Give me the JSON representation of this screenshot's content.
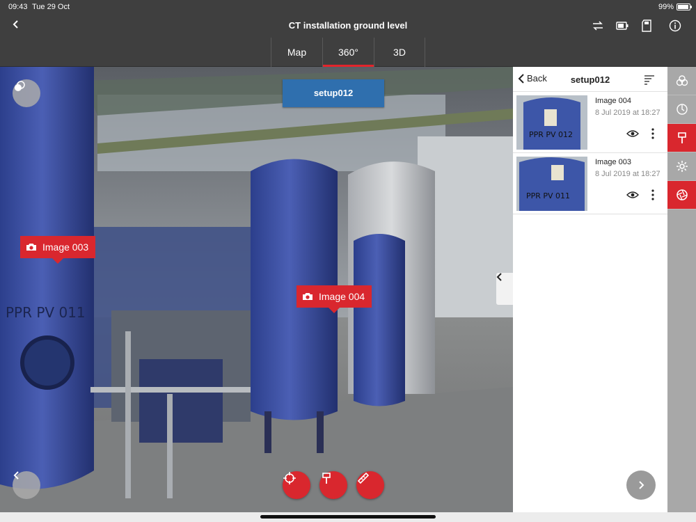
{
  "statusbar": {
    "time": "09:43",
    "date": "Tue 29 Oct",
    "battery": "99%"
  },
  "header": {
    "title": "CT installation ground level"
  },
  "icons": {
    "back": "chevron-left-icon",
    "sync": "sync-icon",
    "battery": "device-battery-icon",
    "sdcard": "sd-card-icon",
    "info": "info-icon"
  },
  "tabs": [
    {
      "label": "Map",
      "active": false
    },
    {
      "label": "360°",
      "active": true
    },
    {
      "label": "3D",
      "active": false
    }
  ],
  "viewer": {
    "setup_label": "setup012",
    "markers": [
      {
        "label": "Image  003"
      },
      {
        "label": "Image  004"
      }
    ]
  },
  "panel": {
    "back_label": "Back",
    "title": "setup012",
    "items": [
      {
        "name": "Image 004",
        "date": "8 Jul 2019 at 18:27",
        "thumb_text": "PPR  PV  012"
      },
      {
        "name": "Image 003",
        "date": "8 Jul 2019 at 18:27",
        "thumb_text": "PPR  PV  011"
      }
    ]
  },
  "colors": {
    "accent": "#d9272e",
    "setup_blue": "#2f6fae",
    "header": "#3f3f3f",
    "toolbar": "#a8a8a8"
  }
}
